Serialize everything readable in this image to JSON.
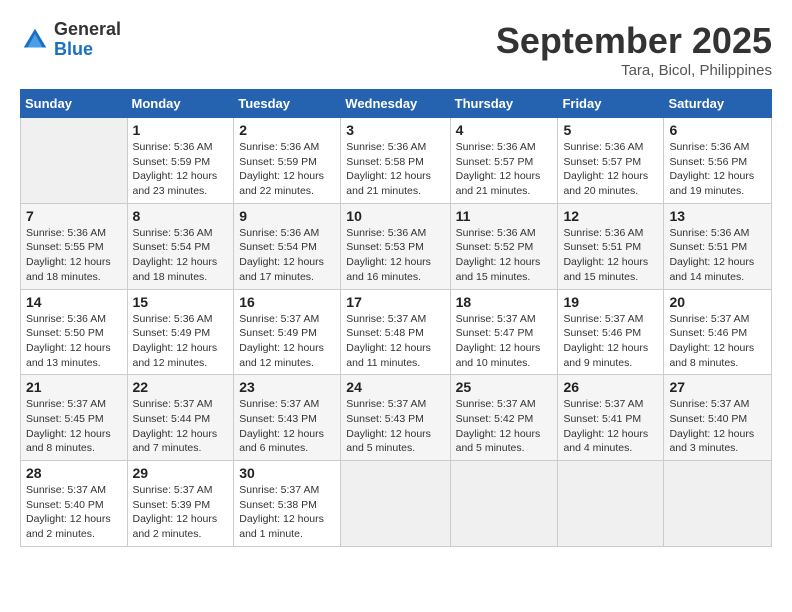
{
  "logo": {
    "general": "General",
    "blue": "Blue"
  },
  "title": {
    "month_year": "September 2025",
    "location": "Tara, Bicol, Philippines"
  },
  "headers": [
    "Sunday",
    "Monday",
    "Tuesday",
    "Wednesday",
    "Thursday",
    "Friday",
    "Saturday"
  ],
  "weeks": [
    [
      {
        "day": "",
        "info": ""
      },
      {
        "day": "1",
        "info": "Sunrise: 5:36 AM\nSunset: 5:59 PM\nDaylight: 12 hours\nand 23 minutes."
      },
      {
        "day": "2",
        "info": "Sunrise: 5:36 AM\nSunset: 5:59 PM\nDaylight: 12 hours\nand 22 minutes."
      },
      {
        "day": "3",
        "info": "Sunrise: 5:36 AM\nSunset: 5:58 PM\nDaylight: 12 hours\nand 21 minutes."
      },
      {
        "day": "4",
        "info": "Sunrise: 5:36 AM\nSunset: 5:57 PM\nDaylight: 12 hours\nand 21 minutes."
      },
      {
        "day": "5",
        "info": "Sunrise: 5:36 AM\nSunset: 5:57 PM\nDaylight: 12 hours\nand 20 minutes."
      },
      {
        "day": "6",
        "info": "Sunrise: 5:36 AM\nSunset: 5:56 PM\nDaylight: 12 hours\nand 19 minutes."
      }
    ],
    [
      {
        "day": "7",
        "info": "Sunrise: 5:36 AM\nSunset: 5:55 PM\nDaylight: 12 hours\nand 18 minutes."
      },
      {
        "day": "8",
        "info": "Sunrise: 5:36 AM\nSunset: 5:54 PM\nDaylight: 12 hours\nand 18 minutes."
      },
      {
        "day": "9",
        "info": "Sunrise: 5:36 AM\nSunset: 5:54 PM\nDaylight: 12 hours\nand 17 minutes."
      },
      {
        "day": "10",
        "info": "Sunrise: 5:36 AM\nSunset: 5:53 PM\nDaylight: 12 hours\nand 16 minutes."
      },
      {
        "day": "11",
        "info": "Sunrise: 5:36 AM\nSunset: 5:52 PM\nDaylight: 12 hours\nand 15 minutes."
      },
      {
        "day": "12",
        "info": "Sunrise: 5:36 AM\nSunset: 5:51 PM\nDaylight: 12 hours\nand 15 minutes."
      },
      {
        "day": "13",
        "info": "Sunrise: 5:36 AM\nSunset: 5:51 PM\nDaylight: 12 hours\nand 14 minutes."
      }
    ],
    [
      {
        "day": "14",
        "info": "Sunrise: 5:36 AM\nSunset: 5:50 PM\nDaylight: 12 hours\nand 13 minutes."
      },
      {
        "day": "15",
        "info": "Sunrise: 5:36 AM\nSunset: 5:49 PM\nDaylight: 12 hours\nand 12 minutes."
      },
      {
        "day": "16",
        "info": "Sunrise: 5:37 AM\nSunset: 5:49 PM\nDaylight: 12 hours\nand 12 minutes."
      },
      {
        "day": "17",
        "info": "Sunrise: 5:37 AM\nSunset: 5:48 PM\nDaylight: 12 hours\nand 11 minutes."
      },
      {
        "day": "18",
        "info": "Sunrise: 5:37 AM\nSunset: 5:47 PM\nDaylight: 12 hours\nand 10 minutes."
      },
      {
        "day": "19",
        "info": "Sunrise: 5:37 AM\nSunset: 5:46 PM\nDaylight: 12 hours\nand 9 minutes."
      },
      {
        "day": "20",
        "info": "Sunrise: 5:37 AM\nSunset: 5:46 PM\nDaylight: 12 hours\nand 8 minutes."
      }
    ],
    [
      {
        "day": "21",
        "info": "Sunrise: 5:37 AM\nSunset: 5:45 PM\nDaylight: 12 hours\nand 8 minutes."
      },
      {
        "day": "22",
        "info": "Sunrise: 5:37 AM\nSunset: 5:44 PM\nDaylight: 12 hours\nand 7 minutes."
      },
      {
        "day": "23",
        "info": "Sunrise: 5:37 AM\nSunset: 5:43 PM\nDaylight: 12 hours\nand 6 minutes."
      },
      {
        "day": "24",
        "info": "Sunrise: 5:37 AM\nSunset: 5:43 PM\nDaylight: 12 hours\nand 5 minutes."
      },
      {
        "day": "25",
        "info": "Sunrise: 5:37 AM\nSunset: 5:42 PM\nDaylight: 12 hours\nand 5 minutes."
      },
      {
        "day": "26",
        "info": "Sunrise: 5:37 AM\nSunset: 5:41 PM\nDaylight: 12 hours\nand 4 minutes."
      },
      {
        "day": "27",
        "info": "Sunrise: 5:37 AM\nSunset: 5:40 PM\nDaylight: 12 hours\nand 3 minutes."
      }
    ],
    [
      {
        "day": "28",
        "info": "Sunrise: 5:37 AM\nSunset: 5:40 PM\nDaylight: 12 hours\nand 2 minutes."
      },
      {
        "day": "29",
        "info": "Sunrise: 5:37 AM\nSunset: 5:39 PM\nDaylight: 12 hours\nand 2 minutes."
      },
      {
        "day": "30",
        "info": "Sunrise: 5:37 AM\nSunset: 5:38 PM\nDaylight: 12 hours\nand 1 minute."
      },
      {
        "day": "",
        "info": ""
      },
      {
        "day": "",
        "info": ""
      },
      {
        "day": "",
        "info": ""
      },
      {
        "day": "",
        "info": ""
      }
    ]
  ]
}
